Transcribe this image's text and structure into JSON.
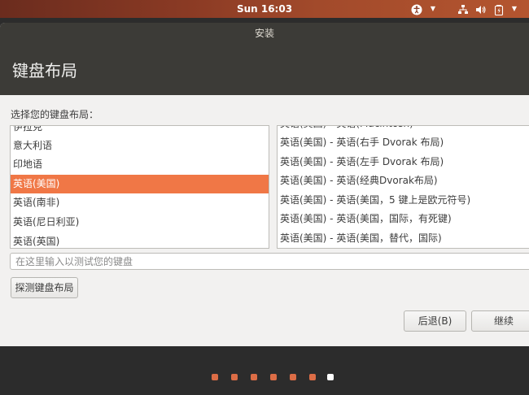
{
  "topbar": {
    "clock": "Sun 16:03"
  },
  "icons": {
    "a11y": "accessibility-icon",
    "network": "network-icon",
    "volume": "volume-icon",
    "battery": "battery-icon"
  },
  "window": {
    "title": "安装",
    "page_title": "键盘布局",
    "prompt": "选择您的键盘布局："
  },
  "layouts": [
    "伊拉克",
    "意大利语",
    "印地语",
    "英语(美国)",
    "英语(南非)",
    "英语(尼日利亚)",
    "英语(英国)"
  ],
  "variants": [
    "英语(美国) - 英语(Macintosh)",
    "英语(美国) - 英语(右手 Dvorak 布局)",
    "英语(美国) - 英语(左手 Dvorak 布局)",
    "英语(美国) - 英语(经典Dvorak布局)",
    "英语(美国) - 英语(美国，5 键上是欧元符号)",
    "英语(美国) - 英语(美国，国际，有死键)",
    "英语(美国) - 英语(美国，替代，国际)"
  ],
  "test_input": {
    "placeholder": "在这里输入以测试您的键盘"
  },
  "buttons": {
    "detect": "探测键盘布局",
    "back": "后退(B)",
    "continue": "继续"
  },
  "colors": {
    "accent": "#f07746",
    "dot_active": "#dc6d46",
    "dot_current": "#ffffff"
  }
}
